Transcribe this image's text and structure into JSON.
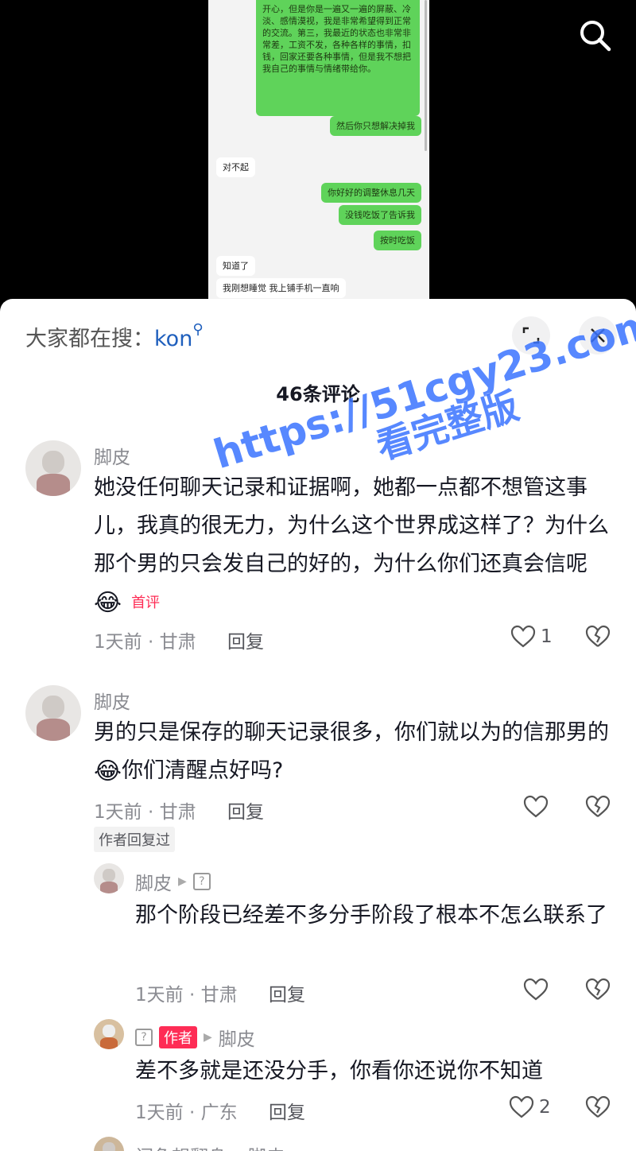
{
  "video": {
    "chat_bubbles": [
      {
        "text": "开心，但是你是一遍又一遍的屏蔽、冷淡、感情漠视，我是非常希望得到正常的交流。第三，我最近的状态也非常非常差，工资不发，各种各样的事情，扣钱，回家还要各种事情，但是我不想把我自己的事情与情绪带给你。",
        "side": "right"
      },
      {
        "text": "然后你只想解决掉我",
        "side": "right"
      },
      {
        "text": "对不起",
        "side": "left"
      },
      {
        "text": "你好好的调整休息几天",
        "side": "right"
      },
      {
        "text": "没钱吃饭了告诉我",
        "side": "right"
      },
      {
        "text": "按时吃饭",
        "side": "right"
      },
      {
        "text": "知道了",
        "side": "left"
      },
      {
        "text": "我刚想睡觉 我上铺手机一直响",
        "side": "left"
      }
    ],
    "search_icon": "search-icon"
  },
  "sheet": {
    "suggest_label": "大家都在搜：",
    "suggest_keyword": "kon",
    "count_title": "46条评论"
  },
  "comments": [
    {
      "username": "脚皮",
      "text": "她没任何聊天记录和证据啊，她都一点都不想管这事儿，我真的很无力，为什么这个世界成这样了？为什么那个男的只会发自己的好的，为什么你们还真会信呢",
      "emoji": "😂",
      "tag": "首评",
      "time_location": "1天前 · 甘肃",
      "reply_label": "回复",
      "likes": "1"
    },
    {
      "username": "脚皮",
      "text_a": "男的只是保存的聊天记录很多，你们就以为的信那男的",
      "emoji": "😂",
      "text_b": "你们清醒点好吗?",
      "time_location": "1天前 · 甘肃",
      "reply_label": "回复",
      "likes": "",
      "author_replied": "作者回复过"
    }
  ],
  "replies": [
    {
      "username": "脚皮",
      "text": "那个阶段已经差不多分手阶段了根本不怎么联系了",
      "time_location": "1天前 · 甘肃",
      "reply_label": "回复",
      "likes": ""
    },
    {
      "author_badge": "作者",
      "reply_to": "脚皮",
      "text": "差不多就是还没分手，你看你还说你不知道",
      "time_location": "1天前 · 广东",
      "reply_label": "回复",
      "likes": "2"
    },
    {
      "username": "闲鱼想翻身",
      "reply_to": "脚皮"
    }
  ],
  "watermark": {
    "line1": "https://51cgy23.com",
    "line2": "看完整版"
  },
  "colors": {
    "accent_red": "#fe2c55",
    "keyword_blue": "#1f5fbd",
    "watermark_blue": "#3a74ff",
    "chat_green": "#5fd35a"
  }
}
